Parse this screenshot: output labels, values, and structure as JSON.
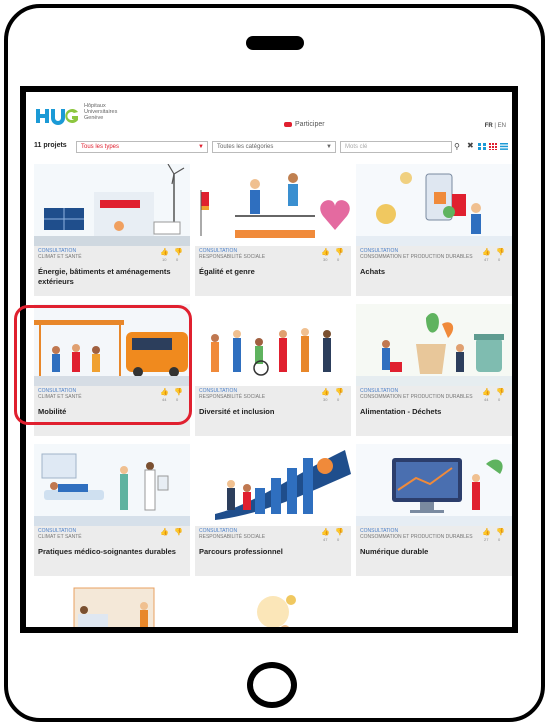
{
  "header": {
    "logo_text": "HUG",
    "logo_caption": [
      "Hôpitaux",
      "Universitaires",
      "Genève"
    ],
    "participate_label": "Participer",
    "lang_active": "FR",
    "lang_other": "EN"
  },
  "toolbar": {
    "count": "11 projets",
    "type_select": "Tous les types",
    "category_select": "Toutes les catégories",
    "search_placeholder": "Mots clé"
  },
  "projects": [
    {
      "type": "CONSULTATION",
      "category": "CLIMAT ET SANTÉ",
      "title": "Énergie, bâtiments et aménagements extérieurs",
      "likes": "10",
      "dislikes": "0"
    },
    {
      "type": "CONSULTATION",
      "category": "RESPONSABILITÉ SOCIALE",
      "title": "Égalité et genre",
      "likes": "30",
      "dislikes": "0"
    },
    {
      "type": "CONSULTATION",
      "category": "CONSOMMATION ET PRODUCTION DURABLES",
      "title": "Achats",
      "likes": "47",
      "dislikes": "0"
    },
    {
      "type": "CONSULTATION",
      "category": "CLIMAT ET SANTÉ",
      "title": "Mobilité",
      "likes": "44",
      "dislikes": "0"
    },
    {
      "type": "CONSULTATION",
      "category": "RESPONSABILITÉ SOCIALE",
      "title": "Diversité et inclusion",
      "likes": "30",
      "dislikes": "0"
    },
    {
      "type": "CONSULTATION",
      "category": "CONSOMMATION ET PRODUCTION DURABLES",
      "title": "Alimentation - Déchets",
      "likes": "44",
      "dislikes": "0"
    },
    {
      "type": "CONSULTATION",
      "category": "CLIMAT ET SANTÉ",
      "title": "Pratiques médico-soignantes durables",
      "likes": "",
      "dislikes": ""
    },
    {
      "type": "CONSULTATION",
      "category": "RESPONSABILITÉ SOCIALE",
      "title": "Parcours professionnel",
      "likes": "47",
      "dislikes": "0"
    },
    {
      "type": "CONSULTATION",
      "category": "CONSOMMATION ET PRODUCTION DURABLES",
      "title": "Numérique durable",
      "likes": "27",
      "dislikes": "0"
    }
  ],
  "colors": {
    "accent": "#e0202f",
    "hug_blue": "#1b9ad6",
    "hug_green": "#8cc63f",
    "card_bg": "#ececec"
  }
}
